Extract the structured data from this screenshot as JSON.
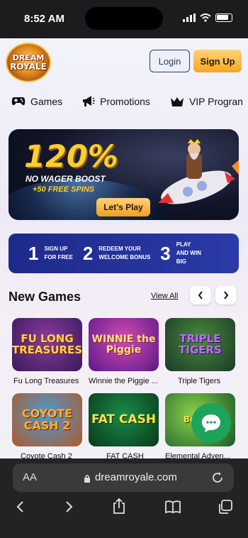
{
  "status_bar": {
    "time": "8:52 AM"
  },
  "logo": {
    "line1": "DREAM",
    "line2": "ROYALE"
  },
  "header": {
    "login_label": "Login",
    "signup_label": "Sign Up"
  },
  "nav": [
    {
      "label": "Games",
      "icon": "gamepad-icon"
    },
    {
      "label": "Promotions",
      "icon": "megaphone-icon"
    },
    {
      "label": "VIP Progran",
      "icon": "crown-icon"
    }
  ],
  "hero": {
    "headline": "120%",
    "line1": "NO WAGER BOOST",
    "line2": "+50 FREE SPINS",
    "cta": "Let's Play"
  },
  "steps": [
    {
      "num": "1",
      "text1": "SIGN UP",
      "text2": "FOR FREE"
    },
    {
      "num": "2",
      "text1": "REDEEM YOUR",
      "text2": "WELCOME BONUS"
    },
    {
      "num": "3",
      "text1": "PLAY",
      "text2": "AND WIN",
      "text3": "BIG"
    }
  ],
  "new_games": {
    "title": "New Games",
    "view_all": "View All",
    "items": [
      {
        "name": "Fu Long Treasures",
        "art": "FU LONG TREASURES"
      },
      {
        "name": "Winnie the Piggie ...",
        "art": "WINNIE the Piggie"
      },
      {
        "name": "Triple Tigers",
        "art": "TRIPLE TIGERS"
      },
      {
        "name": "Coyote Cash 2",
        "art": "COYOTE CASH 2"
      },
      {
        "name": "FAT CASH",
        "art": "FAT CASH"
      },
      {
        "name": "Elemental Adven...",
        "art": "Be Adv"
      }
    ]
  },
  "browser": {
    "aa": "AA",
    "url": "dreamroyale.com"
  }
}
